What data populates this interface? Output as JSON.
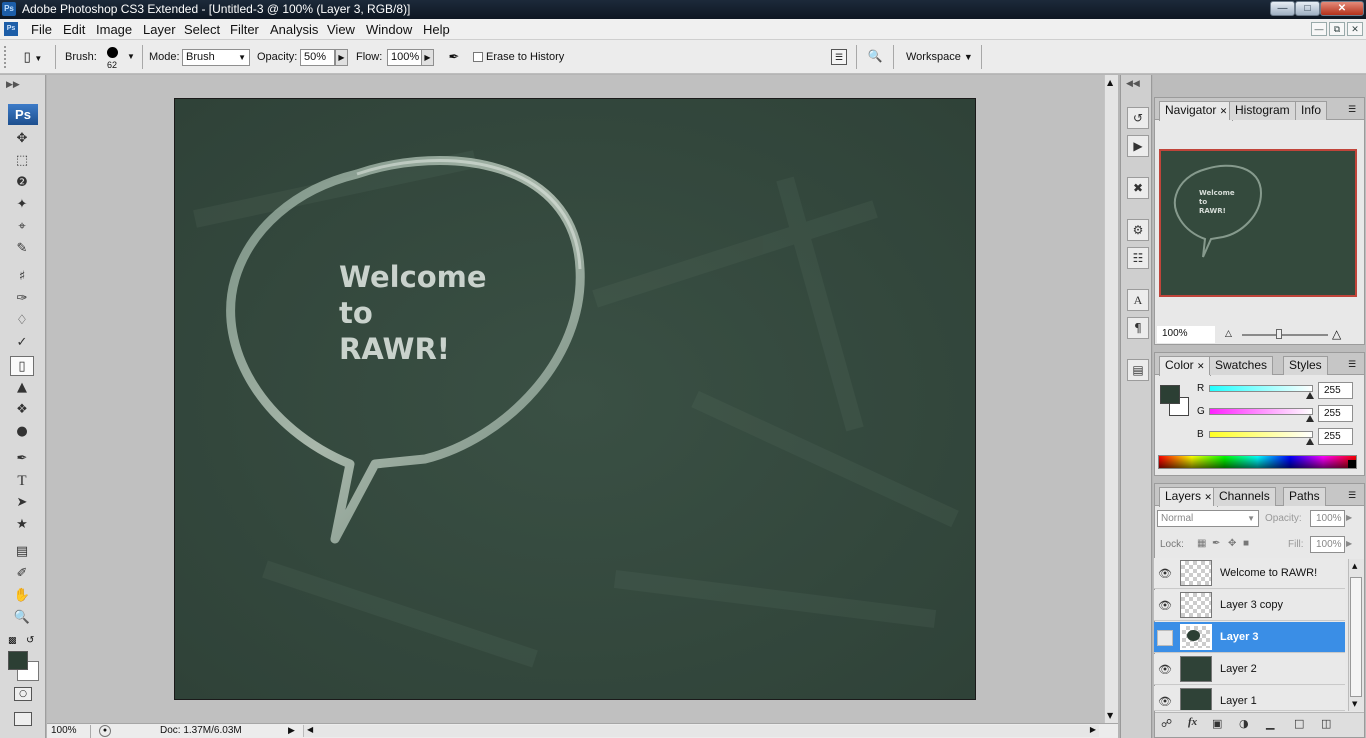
{
  "window": {
    "title": "Adobe Photoshop CS3 Extended - [Untitled-3 @ 100% (Layer 3, RGB/8)]",
    "app_icon": "Ps",
    "buttons": [
      "minimize",
      "maximize",
      "close"
    ]
  },
  "menu": [
    "File",
    "Edit",
    "Image",
    "Layer",
    "Select",
    "Filter",
    "Analysis",
    "View",
    "Window",
    "Help"
  ],
  "options": {
    "brush_label": "Brush:",
    "brush_size": "62",
    "mode_label": "Mode:",
    "mode_value": "Brush",
    "opacity_label": "Opacity:",
    "opacity_value": "50%",
    "flow_label": "Flow:",
    "flow_value": "100%",
    "erase_history_label": "Erase to History",
    "workspace_label": "Workspace"
  },
  "toolbox": {
    "ps_logo": "Ps",
    "foreground_color": "#2c3f34",
    "background_color": "#ffffff"
  },
  "canvas": {
    "background_color": "#354a3e",
    "bubble_text": [
      "Welcome",
      "to",
      "RAWR!"
    ]
  },
  "status": {
    "zoom": "100%",
    "doc_info": "Doc: 1.37M/6.03M"
  },
  "navigator": {
    "tabs": [
      "Navigator",
      "Histogram",
      "Info"
    ],
    "zoom_value": "100%",
    "preview_text": [
      "Welcome",
      "to",
      "RAWR!"
    ]
  },
  "color_panel": {
    "tabs": [
      "Color",
      "Swatches",
      "Styles"
    ],
    "channels": [
      {
        "label": "R",
        "value": "255"
      },
      {
        "label": "G",
        "value": "255"
      },
      {
        "label": "B",
        "value": "255"
      }
    ],
    "foreground": "#2c3f34"
  },
  "layers_panel": {
    "tabs": [
      "Layers",
      "Channels",
      "Paths"
    ],
    "blend_mode": "Normal",
    "opacity_label": "Opacity:",
    "opacity_value": "100%",
    "lock_label": "Lock:",
    "fill_label": "Fill:",
    "fill_value": "100%",
    "layers": [
      {
        "name": "Welcome  to RAWR!",
        "visible": true,
        "selected": false
      },
      {
        "name": "Layer 3 copy",
        "visible": true,
        "selected": false
      },
      {
        "name": "Layer 3",
        "visible": false,
        "selected": true
      },
      {
        "name": "Layer 2",
        "visible": true,
        "selected": false
      },
      {
        "name": "Layer 1",
        "visible": true,
        "selected": false
      }
    ]
  }
}
